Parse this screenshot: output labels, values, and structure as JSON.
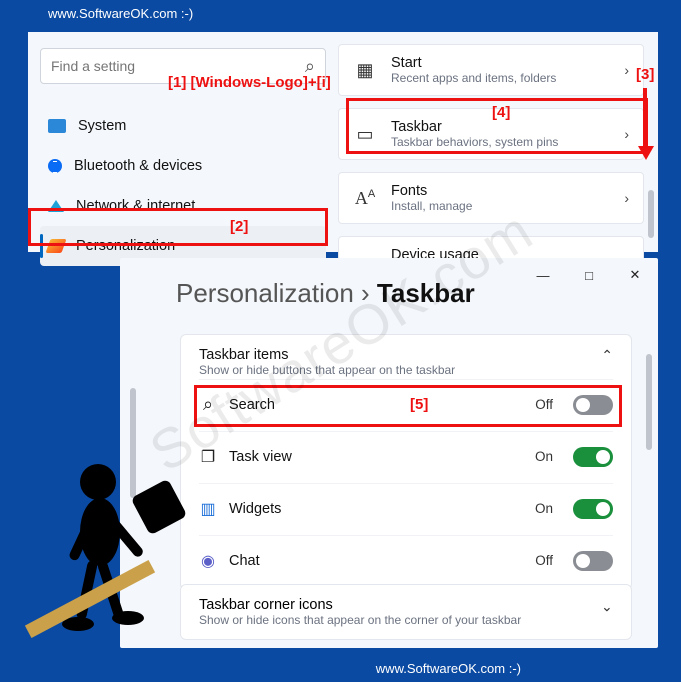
{
  "branding": {
    "text": "www.SoftwareOK.com  :-)"
  },
  "watermark": "SoftwareOK.com",
  "annotations": {
    "a1": "[1]  [Windows-Logo]+[i]",
    "a2": "[2]",
    "a3": "[3]",
    "a4": "[4]",
    "a5": "[5]"
  },
  "panel1": {
    "search_placeholder": "Find a setting",
    "nav": [
      {
        "label": "System"
      },
      {
        "label": "Bluetooth & devices"
      },
      {
        "label": "Network & internet"
      },
      {
        "label": "Personalization"
      }
    ],
    "cards": [
      {
        "title": "Start",
        "subtitle": "Recent apps and items, folders"
      },
      {
        "title": "Taskbar",
        "subtitle": "Taskbar behaviors, system pins"
      },
      {
        "title": "Fonts",
        "subtitle": "Install, manage"
      },
      {
        "title": "Device usage",
        "subtitle": ""
      }
    ]
  },
  "panel2": {
    "crumb_parent": "Personalization",
    "crumb_sep": "›",
    "crumb_current": "Taskbar",
    "section1": {
      "title": "Taskbar items",
      "subtitle": "Show or hide buttons that appear on the taskbar",
      "items": [
        {
          "label": "Search",
          "state": "Off",
          "on": false
        },
        {
          "label": "Task view",
          "state": "On",
          "on": true
        },
        {
          "label": "Widgets",
          "state": "On",
          "on": true
        },
        {
          "label": "Chat",
          "state": "Off",
          "on": false
        }
      ]
    },
    "section2": {
      "title": "Taskbar corner icons",
      "subtitle": "Show or hide icons that appear on the corner of your taskbar"
    }
  }
}
